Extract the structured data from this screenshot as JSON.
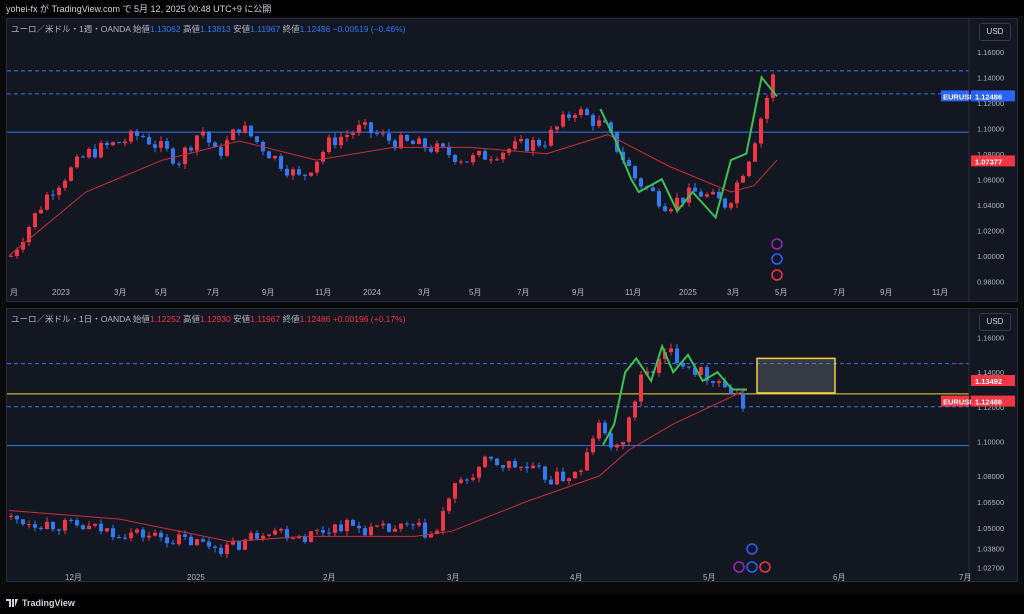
{
  "header": {
    "publish_line": "yohei-fx が TradingView.com で 5月 12, 2025 00:48 UTC+9 に公開"
  },
  "colors": {
    "up": "#f23645",
    "down": "#3179f5",
    "ma_red": "#c8303c",
    "ma_green": "#3cc152",
    "blue_line": "#3179f5",
    "yellow": "#f0d43a"
  },
  "pane1": {
    "legend_symbol": "ユーロ／米ドル・1週・OANDA",
    "o_label": "始値",
    "o": "1.13062",
    "h_label": "高値",
    "h": "1.13813",
    "l_label": "安値",
    "l": "1.11967",
    "c_label": "終値",
    "c": "1.12486",
    "change": "−0.00519 (−0.46%)",
    "currency": "USD",
    "y_ticks": [
      "1.16000",
      "1.14000",
      "1.12000",
      "1.10000",
      "1.08000",
      "1.06000",
      "1.04000",
      "1.02000",
      "1.00000",
      "0.98000"
    ],
    "x_ticks": [
      "月",
      "2023",
      "3月",
      "5月",
      "7月",
      "9月",
      "11月",
      "2024",
      "3月",
      "5月",
      "7月",
      "9月",
      "11月",
      "2025",
      "3月",
      "5月",
      "7月",
      "9月",
      "11月"
    ],
    "price_tag_label": "EURUSD",
    "price_tag_value": "1.12486",
    "ma_tag_value": "1.07377",
    "icons": [
      "lightning-icon",
      "us-flag-icon",
      "eu-us-event-icon"
    ]
  },
  "pane2": {
    "legend_symbol": "ユーロ／米ドル・1日・OANDA",
    "o_label": "始値",
    "o": "1.12252",
    "h_label": "高値",
    "h": "1.12930",
    "l_label": "安値",
    "l": "1.11967",
    "c_label": "終値",
    "c": "1.12486",
    "change": "+0.00196 (+0.17%)",
    "currency": "USD",
    "y_ticks": [
      "1.16000",
      "1.14000",
      "1.12000",
      "1.10000",
      "1.08000",
      "1.06500",
      "1.05000",
      "1.03800",
      "1.02700"
    ],
    "x_ticks": [
      "12月",
      "2025",
      "2月",
      "3月",
      "4月",
      "5月",
      "6月",
      "7月"
    ],
    "price_tag_label": "EURUSD",
    "price_tag_value": "1.12486",
    "yellow_tag_value": "1.13492",
    "icons": [
      "lightning-icon",
      "us-flag-icon",
      "eu-flag-icon"
    ]
  },
  "footer": {
    "brand": "TradingView"
  }
}
